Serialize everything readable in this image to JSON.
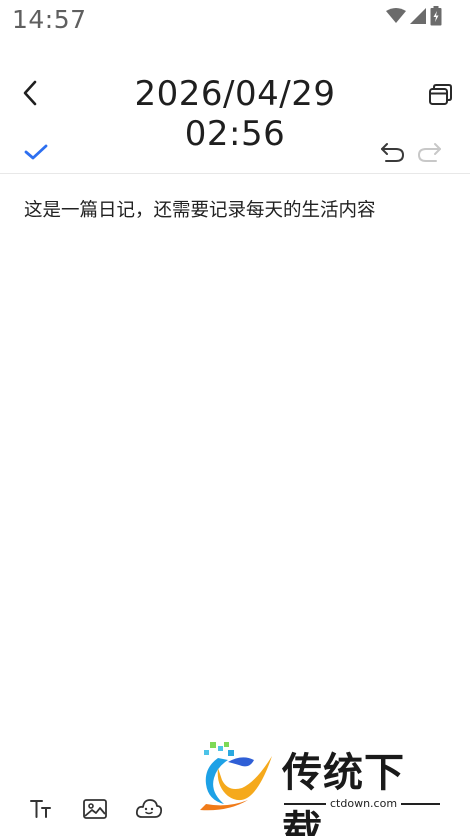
{
  "status_bar": {
    "time": "14:57",
    "icons": [
      "wifi-icon",
      "cellular-signal-icon",
      "battery-charging-icon"
    ]
  },
  "header": {
    "title": "2026/04/29 02:56",
    "back_icon": "chevron-left-icon",
    "window_icon": "windows-stack-icon"
  },
  "toolbar": {
    "check_icon": "checkmark-icon",
    "undo_icon": "undo-icon",
    "redo_icon": "redo-icon",
    "accent_color": "#2d6ff0"
  },
  "editor": {
    "text": "这是一篇日记，还需要记录每天的生活内容"
  },
  "bottom_tools": [
    "text-format-icon",
    "image-icon",
    "mood-icon"
  ],
  "watermark": {
    "title": "传统下载",
    "subtitle": "ctdown.com"
  }
}
